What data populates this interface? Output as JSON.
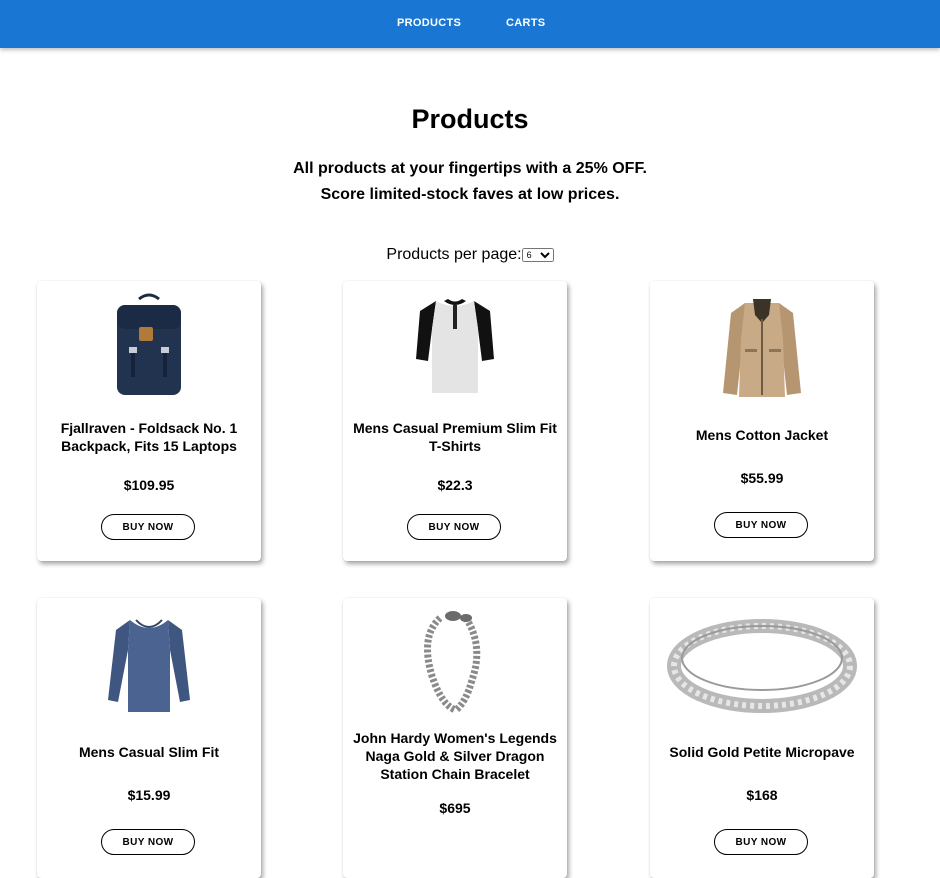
{
  "nav": {
    "products_label": "PRODUCTS",
    "carts_label": "CARTS"
  },
  "header": {
    "title": "Products",
    "subtitle_line1": "All products at your fingertips with a 25% OFF.",
    "subtitle_line2": "Score limited-stock faves at low prices."
  },
  "pagination": {
    "label": "Products per page:",
    "selected": "6",
    "options": [
      "6"
    ]
  },
  "products": [
    {
      "title": "Fjallraven - Foldsack No. 1 Backpack, Fits 15 Laptops",
      "price": "$109.95",
      "button": "BUY NOW",
      "image": "backpack-image"
    },
    {
      "title": "Mens Casual Premium Slim Fit T-Shirts",
      "price": "$22.3",
      "button": "BUY NOW",
      "image": "tshirt-image"
    },
    {
      "title": "Mens Cotton Jacket",
      "price": "$55.99",
      "button": "BUY NOW",
      "image": "jacket-image"
    },
    {
      "title": "Mens Casual Slim Fit",
      "price": "$15.99",
      "button": "BUY NOW",
      "image": "longsleeve-image"
    },
    {
      "title": "John Hardy Women's Legends Naga Gold & Silver Dragon Station Chain Bracelet",
      "price": "$695",
      "button": "BUY NOW",
      "image": "bracelet-image"
    },
    {
      "title": "Solid Gold Petite Micropave",
      "price": "$168",
      "button": "BUY NOW",
      "image": "ring-image"
    }
  ],
  "colors": {
    "topbar": "#1976d2",
    "text": "#000000",
    "background": "#ffffff"
  }
}
